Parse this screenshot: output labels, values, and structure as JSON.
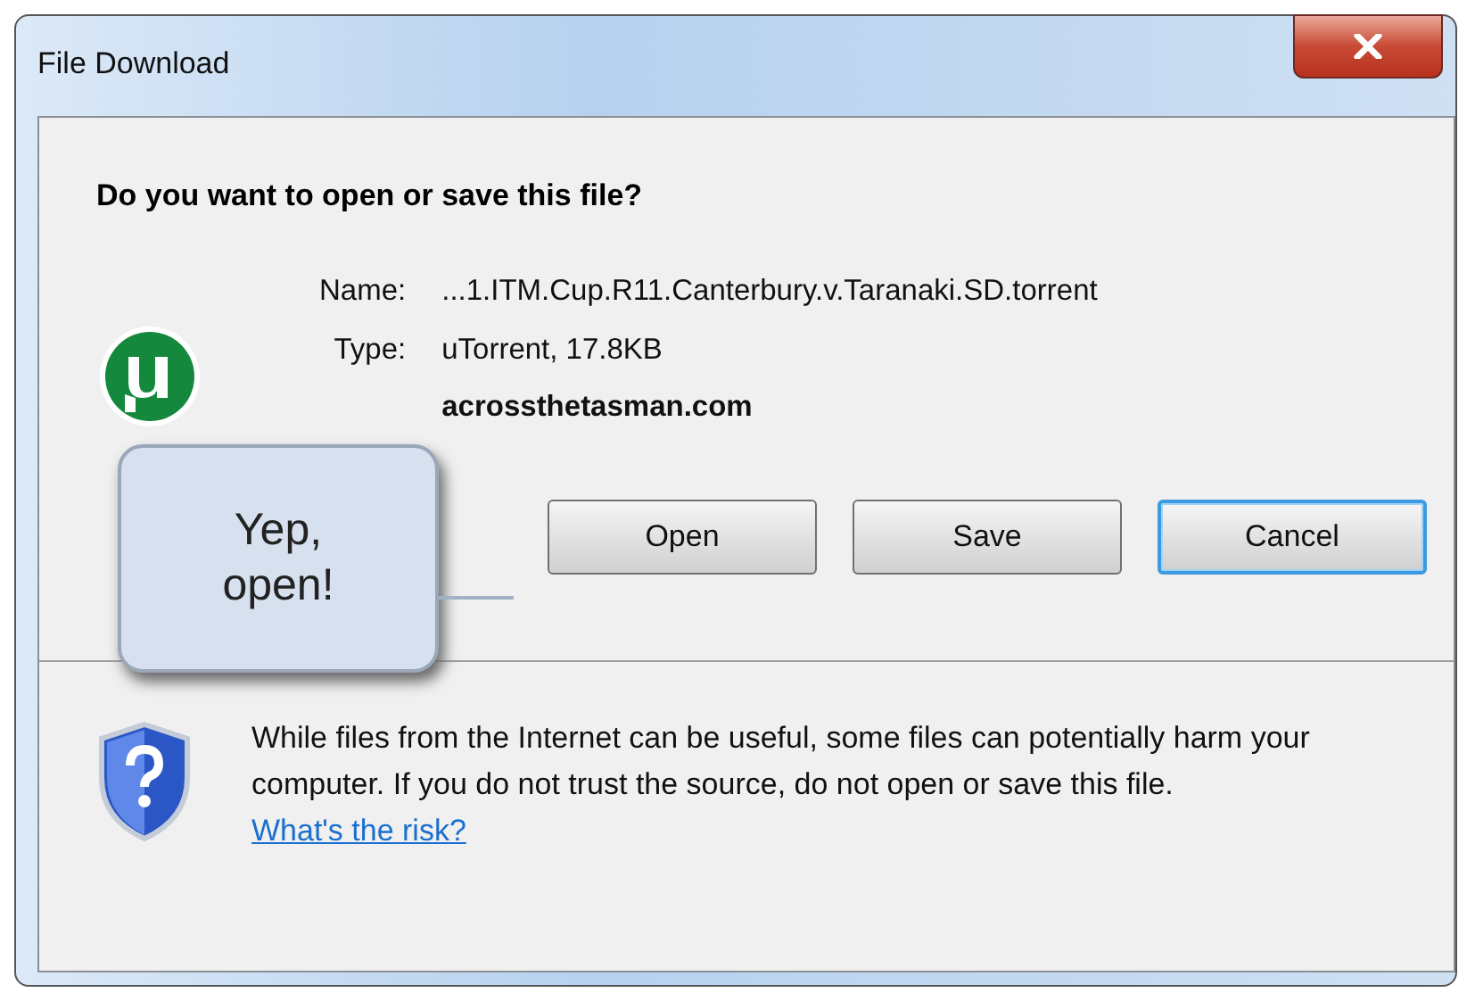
{
  "window": {
    "title": "File Download"
  },
  "question": "Do you want to open or save this file?",
  "fields": [
    {
      "label": "Name:",
      "value": "...1.ITM.Cup.R11.Canterbury.v.Taranaki.SD.torrent",
      "bold": false
    },
    {
      "label": "Type:",
      "value": "uTorrent, 17.8KB",
      "bold": false
    },
    {
      "value": "acrossthetasman.com",
      "bold": true
    }
  ],
  "buttons": [
    {
      "label": "Open",
      "default": false
    },
    {
      "label": "Save",
      "default": false
    },
    {
      "label": "Cancel",
      "default": true
    }
  ],
  "callout": {
    "text": "Yep, open!"
  },
  "warning": {
    "text": "While files from the Internet can be useful, some files can potentially harm your computer. If you do not trust the source, do not open or save this file.",
    "link": "What's the risk?"
  }
}
